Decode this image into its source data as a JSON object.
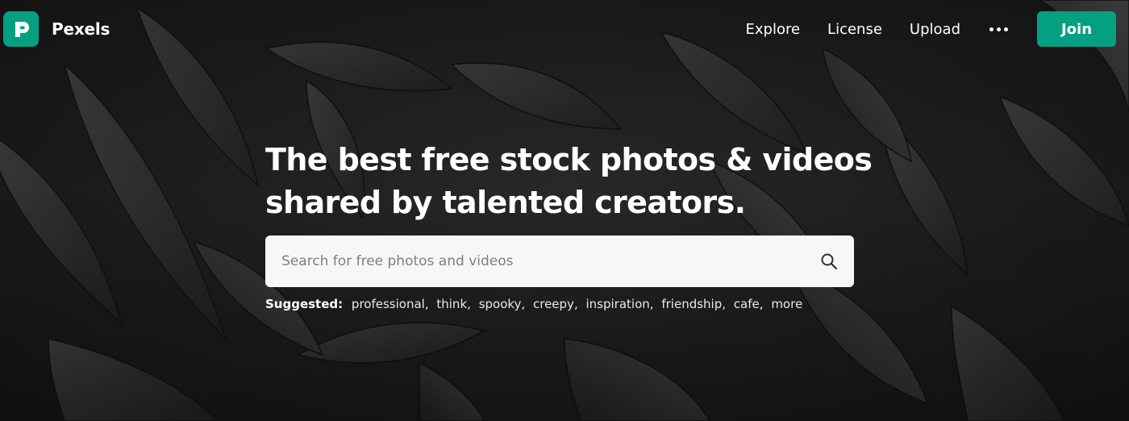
{
  "brand": {
    "name": "Pexels",
    "color": "#05a081"
  },
  "nav": {
    "links": [
      "Explore",
      "License",
      "Upload"
    ],
    "more_icon": "more-horizontal-icon",
    "join_label": "Join"
  },
  "hero": {
    "headline_line1": "The best free stock photos & videos",
    "headline_line2": "shared by talented creators.",
    "background": "dark leaves photo (grayscale)"
  },
  "search": {
    "placeholder": "Search for free photos and videos",
    "value": "",
    "icon": "search-icon"
  },
  "suggested": {
    "label": "Suggested:",
    "tags": [
      "professional",
      "think",
      "spooky",
      "creepy",
      "inspiration",
      "friendship",
      "cafe",
      "more"
    ]
  }
}
